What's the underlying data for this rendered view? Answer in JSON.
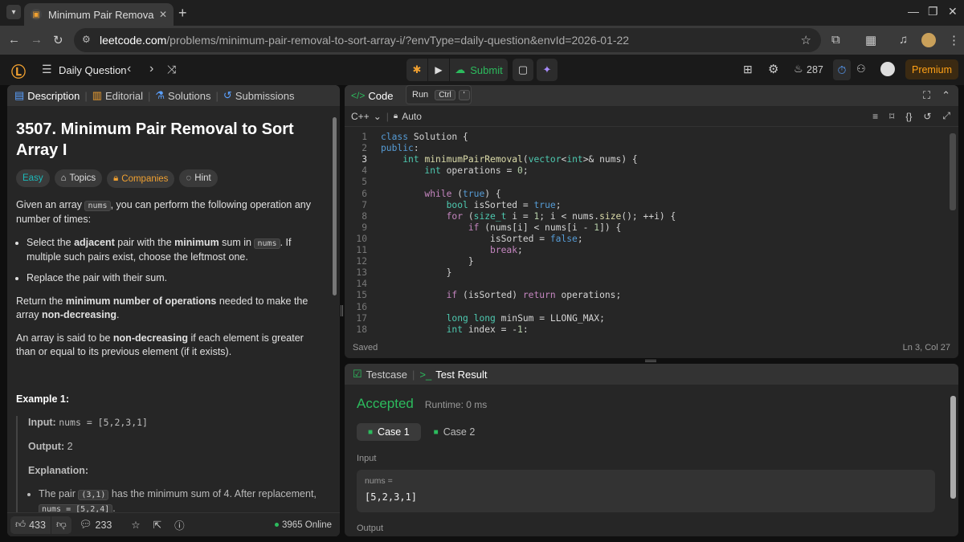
{
  "browser": {
    "tab_title": "Minimum Pair Removal to S",
    "url_host": "leetcode.com",
    "url_path": "/problems/minimum-pair-removal-to-sort-array-i/?envType=daily-question&envId=2026-01-22"
  },
  "nav": {
    "daily_label": "Daily Question",
    "submit_label": "Submit",
    "streak_count": "287",
    "premium_label": "Premium",
    "tooltip_run": "Run",
    "tooltip_ctrl": "Ctrl",
    "tooltip_key": "'"
  },
  "left_tabs": {
    "description": "Description",
    "editorial": "Editorial",
    "solutions": "Solutions",
    "submissions": "Submissions"
  },
  "problem": {
    "title": "3507. Minimum Pair Removal to Sort Array I",
    "chip_easy": "Easy",
    "chip_topics": "Topics",
    "chip_companies": "Companies",
    "chip_hint": "Hint",
    "p1_a": "Given an array ",
    "p1_code": "nums",
    "p1_b": ", you can perform the following operation any number of times:",
    "b1_a": "Select the ",
    "b1_bold1": "adjacent",
    "b1_b": " pair with the ",
    "b1_bold2": "minimum",
    "b1_c": " sum in ",
    "b1_code": "nums",
    "b1_d": ". If multiple such pairs exist, choose the leftmost one.",
    "b2": "Replace the pair with their sum.",
    "p2_a": "Return the ",
    "p2_bold1": "minimum number of operations",
    "p2_b": " needed to make the array ",
    "p2_bold2": "non-decreasing",
    "p2_c": ".",
    "p3_a": "An array is said to be ",
    "p3_bold": "non-decreasing",
    "p3_b": " if each element is greater than or equal to its previous element (if it exists).",
    "example_title": "Example 1:",
    "input_label": "Input:",
    "input_value": "nums = [5,2,3,1]",
    "output_label": "Output:",
    "output_value": "2",
    "explanation_label": "Explanation:",
    "exp_a": "The pair ",
    "exp_code1": "(3,1)",
    "exp_b": " has the minimum sum of 4. After replacement, ",
    "exp_code2": "nums = [5,2,4]",
    "exp_c": "."
  },
  "footer": {
    "likes": "433",
    "comments": "233",
    "online": "3965 Online"
  },
  "code_panel": {
    "title": "Code",
    "language": "C++",
    "mode": "Auto",
    "status_left": "Saved",
    "status_right": "Ln 3, Col 27",
    "lines": [
      {
        "n": "1",
        "t": "class Solution {"
      },
      {
        "n": "2",
        "t": "public:"
      },
      {
        "n": "3",
        "t": "    int minimumPairRemoval(vector<int>& nums) {"
      },
      {
        "n": "4",
        "t": "        int operations = 0;"
      },
      {
        "n": "5",
        "t": ""
      },
      {
        "n": "6",
        "t": "        while (true) {"
      },
      {
        "n": "7",
        "t": "            bool isSorted = true;"
      },
      {
        "n": "8",
        "t": "            for (size_t i = 1; i < nums.size(); ++i) {"
      },
      {
        "n": "9",
        "t": "                if (nums[i] < nums[i - 1]) {"
      },
      {
        "n": "10",
        "t": "                    isSorted = false;"
      },
      {
        "n": "11",
        "t": "                    break;"
      },
      {
        "n": "12",
        "t": "                }"
      },
      {
        "n": "13",
        "t": "            }"
      },
      {
        "n": "14",
        "t": ""
      },
      {
        "n": "15",
        "t": "            if (isSorted) return operations;"
      },
      {
        "n": "16",
        "t": ""
      },
      {
        "n": "17",
        "t": "            long long minSum = LLONG_MAX;"
      },
      {
        "n": "18",
        "t": "            int index = -1;"
      }
    ]
  },
  "test_panel": {
    "tab_testcase": "Testcase",
    "tab_result": "Test Result",
    "status": "Accepted",
    "runtime": "Runtime: 0 ms",
    "case1": "Case 1",
    "case2": "Case 2",
    "input_label": "Input",
    "var_label": "nums =",
    "var_value": "[5,2,3,1]",
    "output_label": "Output"
  }
}
